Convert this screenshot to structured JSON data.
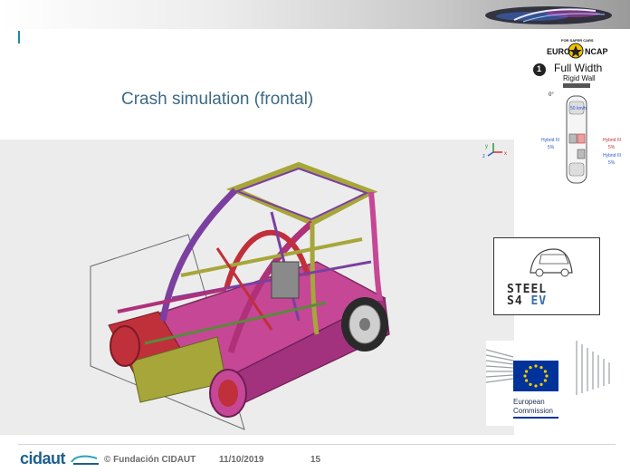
{
  "slide": {
    "title": "Crash simulation (frontal)",
    "page_number": "15"
  },
  "footer": {
    "logo_text": "cidaut",
    "copyright": "© Fundación CIDAUT",
    "date": "11/10/2019"
  },
  "ncap": {
    "badge_left": "EURO",
    "badge_right": "NCAP",
    "badge_arc": "FOR SAFER CARS",
    "test_number": "1",
    "test_name": "Full Width",
    "wall_label": "Rigid Wall",
    "angle": "0°",
    "speed": "50 km/h",
    "dummy_left": "Hybrid III",
    "dummy_left_pct": "5%",
    "dummy_right_top": "Hybrid III",
    "dummy_right_top_pct": "5%",
    "dummy_right_bottom": "Hybrid III",
    "dummy_right_bottom_pct": "5%"
  },
  "project_logo": {
    "line1": "STEEL",
    "line2_a": "S4",
    "line2_b": "EV"
  },
  "eu_logo": {
    "line1": "European",
    "line2": "Commission"
  },
  "axis_triad": {
    "y": "y",
    "z": "z",
    "x": "x"
  },
  "colors": {
    "title": "#3d6a85",
    "accent": "#1a8ea0",
    "cidaut_blue": "#1d5e8f",
    "eu_blue": "#003399",
    "eu_star": "#ffcc00",
    "frame_magenta": "#b0307a",
    "frame_purple": "#7b3fa0",
    "frame_olive": "#a6a63a",
    "frame_red": "#c0303a"
  },
  "icons": [
    "ncap-star-icon",
    "car-outline-icon",
    "eu-flag-icon",
    "axis-triad-icon",
    "wheel-icon"
  ]
}
